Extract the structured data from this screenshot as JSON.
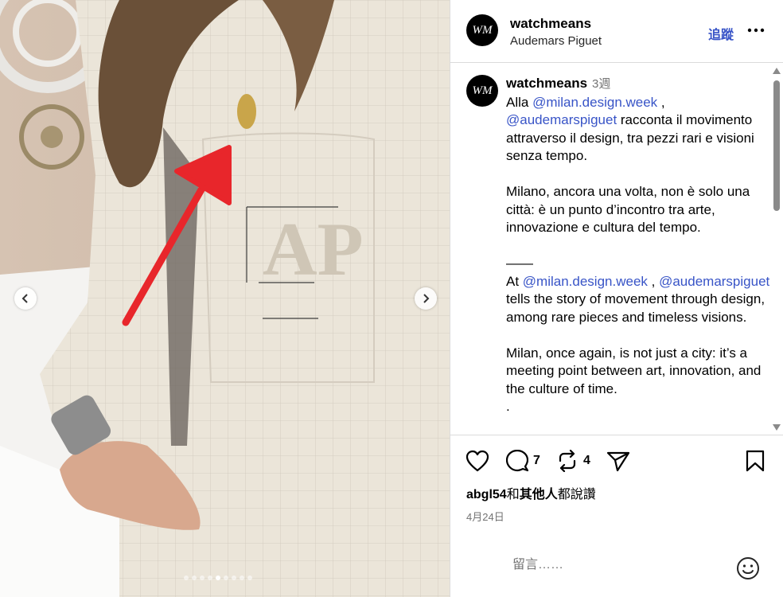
{
  "post": {
    "username": "watchmeans",
    "location": "Audemars Piguet",
    "follow_label": "追蹤",
    "caption_username": "watchmeans",
    "caption_time": "3週",
    "caption": {
      "p1_a": "Alla ",
      "p1_m1": "@milan.design.week",
      "p1_b": " , ",
      "p1_m2": "@audemarspiguet",
      "p1_c": " racconta il movimento attraverso il design, tra pezzi rari e visioni senza tempo.",
      "p2": "Milano, ancora una volta, non è solo una città: è un punto d’incontro tra arte, innovazione e cultura del tempo.",
      "separator": "——",
      "p3_a": "At ",
      "p3_m1": "@milan.design.week",
      "p3_b": " , ",
      "p3_m2": "@audemarspiguet",
      "p3_c": " tells the story of movement through design, among rare pieces and timeless visions.",
      "p4": "Milan, once again, is not just a city: it’s a meeting point between art, innovation, and the culture of time.",
      "p5": "."
    },
    "comments_count": "7",
    "reposts_count": "4",
    "likes_prefix": "abgl54",
    "likes_mid": "和",
    "likes_others": "其他人",
    "likes_suffix": "都說讚",
    "date": "4月24日",
    "comment_placeholder": "留言……",
    "carousel": {
      "total": 9,
      "active_index": 4
    }
  },
  "icons": {
    "prev": "chevron-left-icon",
    "next": "chevron-right-icon",
    "like": "heart-icon",
    "comment": "comment-bubble-icon",
    "repost": "repost-icon",
    "share": "paper-plane-icon",
    "save": "bookmark-icon",
    "more": "more-dots-icon",
    "emoji": "emoji-smile-icon"
  },
  "colors": {
    "link": "#3854c7",
    "muted": "#737373",
    "arrow": "#e8262b"
  }
}
